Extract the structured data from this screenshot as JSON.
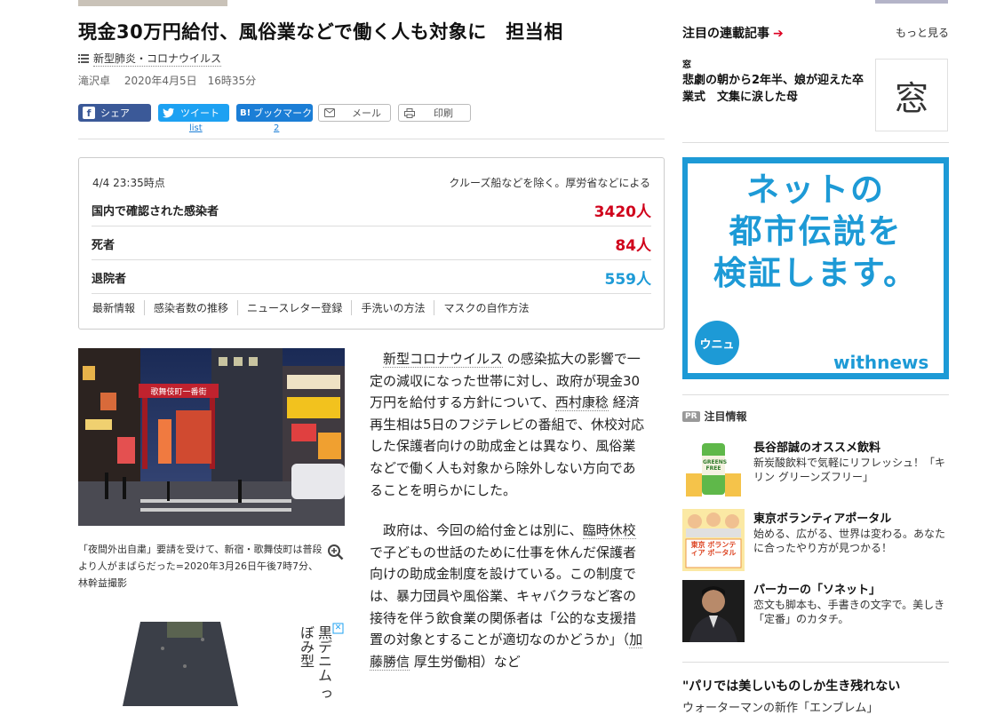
{
  "article": {
    "title": "現金30万円給付、風俗業などで働く人も対象に　担当相",
    "topic_tag": "新型肺炎・コロナウイルス",
    "author": "滝沢卓",
    "date": "2020年4月5日　16時35分",
    "share": {
      "facebook": "シェア",
      "twitter": "ツイート",
      "hatena_icon": "B!",
      "hatena": "ブックマーク",
      "mail": "メール",
      "print": "印刷",
      "twitter_count": "list",
      "hatena_count": "2"
    },
    "photo_caption": "「夜間外出自粛」要請を受けて、新宿・歌舞伎町は普段より人がまばらだった=2020年3月26日午後7時7分、林幹益撮影",
    "photo_sign": "歌舞伎町一番街",
    "ad_text": "黒デニム っぼみ型",
    "paragraphs": {
      "p1_pre": "",
      "p1_kw1": "新型コロナウイルス",
      "p1_mid": " の感染拡大の影響で一定の減収になった世帯に対し、政府が現金30万円を給付する方針について、",
      "p1_kw2": "西村康稔",
      "p1_post": " 経済再生相は5日のフジテレビの番組で、休校対応した保護者向けの助成金とは異なり、風俗業などで働く人も対象から除外しない方向であることを明らかにした。",
      "p2_pre": "政府は、今回の給付金とは別に、",
      "p2_kw1": "臨時休校",
      "p2_post": " で子どもの世話のために仕事を休んだ保護者向けの助成金制度を設けている。この制度では、暴力団員や風俗業、キャバクラなど客の接待を伴う飲食業の関係者は「公的な支援措置の対象とすることが適切なのかどうか」（",
      "p2_kw2": "加藤勝信",
      "p2_post2": " 厚生労働相）など"
    }
  },
  "stats_box": {
    "time": "4/4 23:35時点",
    "note": "クルーズ船などを除く。厚労省などによる",
    "rows": [
      {
        "label": "国内で確認された感染者",
        "value": "3420人",
        "color": "#d0021b"
      },
      {
        "label": "死者",
        "value": "84人",
        "color": "#d0021b"
      },
      {
        "label": "退院者",
        "value": "559人",
        "color": "#1d9ad6"
      }
    ],
    "links": [
      "最新情報",
      "感染者数の推移",
      "ニュースレター登録",
      "手洗いの方法",
      "マスクの自作方法"
    ]
  },
  "sidebar": {
    "series_title": "注目の連載記事",
    "more": "もっと見る",
    "series_source": "窓",
    "series_headline": "悲劇の朝から2年半、娘が迎えた卒業式　文集に涙した母",
    "series_thumb_char": "窓",
    "banner": {
      "line1": "ネットの",
      "line2": "都市伝説を",
      "line3": "検証します。",
      "badge": "ウニュ",
      "logo": "withnews"
    },
    "pr_badge": "PR",
    "pr_title": "注目情報",
    "pr_items": [
      {
        "title": "長谷部誠のオススメ飲料",
        "desc": "新炭酸飲料で気軽にリフレッシュ！「キリン グリーンズフリー」",
        "img_text": "GREENS FREE"
      },
      {
        "title": "東京ボランティアポータル",
        "desc": "始める、広がる、世界は変わる。あなたに合ったやり方が見つかる！",
        "img_text": "東京 ボランティア ポータル"
      },
      {
        "title": "パーカーの「ソネット」",
        "desc": "恋文も脚本も、手書きの文字で。美しき「定番」のカタチ。",
        "img_text": ""
      }
    ],
    "bottom_title": "\"パリでは美しいものしか生き残れない",
    "bottom_sub": "ウォーターマンの新作「エンブレム」"
  }
}
